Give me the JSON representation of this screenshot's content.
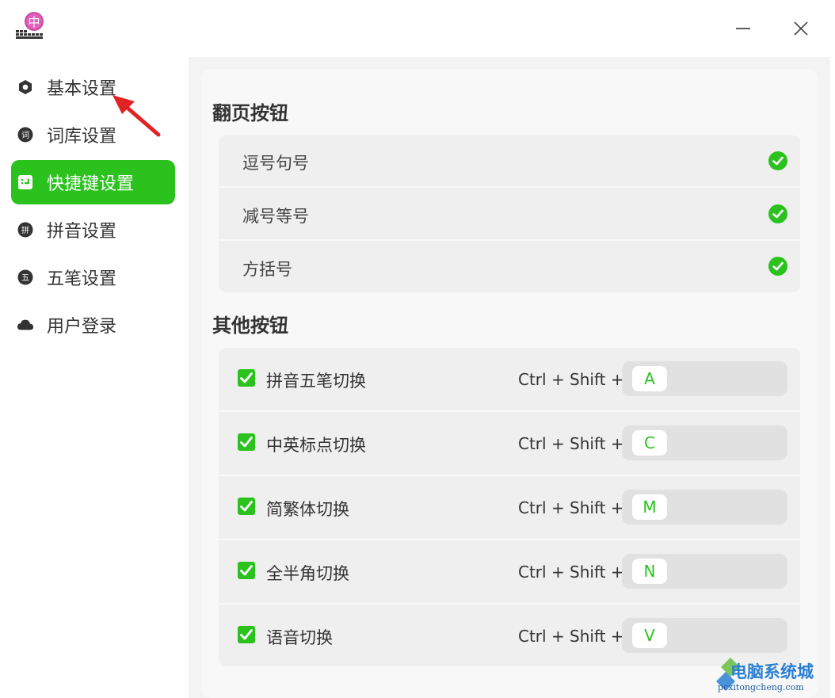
{
  "titlebar": {
    "app_icon_char": "中",
    "minimize_icon": "minimize-icon",
    "close_icon": "close-icon"
  },
  "sidebar": {
    "items": [
      {
        "label": "基本设置",
        "icon": "hexagon-icon",
        "active": false
      },
      {
        "label": "词库设置",
        "icon": "dictionary-icon",
        "glyph": "词",
        "active": false
      },
      {
        "label": "快捷键设置",
        "icon": "keyboard-icon",
        "active": true
      },
      {
        "label": "拼音设置",
        "icon": "pinyin-icon",
        "glyph": "拼",
        "active": false
      },
      {
        "label": "五笔设置",
        "icon": "wubi-icon",
        "glyph": "五",
        "active": false
      },
      {
        "label": "用户登录",
        "icon": "cloud-icon",
        "active": false
      }
    ]
  },
  "page_turn": {
    "title": "翻页按钮",
    "items": [
      {
        "label": "逗号句号",
        "checked": true
      },
      {
        "label": "减号等号",
        "checked": true
      },
      {
        "label": "方括号",
        "checked": true
      }
    ]
  },
  "other": {
    "title": "其他按钮",
    "items": [
      {
        "label": "拼音五笔切换",
        "modifier": "Ctrl + Shift +",
        "key": "A",
        "checked": true
      },
      {
        "label": "中英标点切换",
        "modifier": "Ctrl + Shift +",
        "key": "C",
        "checked": true
      },
      {
        "label": "简繁体切换",
        "modifier": "Ctrl + Shift +",
        "key": "M",
        "checked": true
      },
      {
        "label": "全半角切换",
        "modifier": "Ctrl + Shift +",
        "key": "N",
        "checked": true
      },
      {
        "label": "语音切换",
        "modifier": "Ctrl + Shift +",
        "key": "V",
        "checked": true
      }
    ]
  },
  "watermark": {
    "title": "电脑系统城",
    "url": "pcxitongcheng.com"
  },
  "colors": {
    "accent": "#2bc21e",
    "sidebar_bg": "#ffffff",
    "content_bg": "#f8f8f8",
    "row_bg": "#efefef",
    "arrow": "#e02424"
  }
}
